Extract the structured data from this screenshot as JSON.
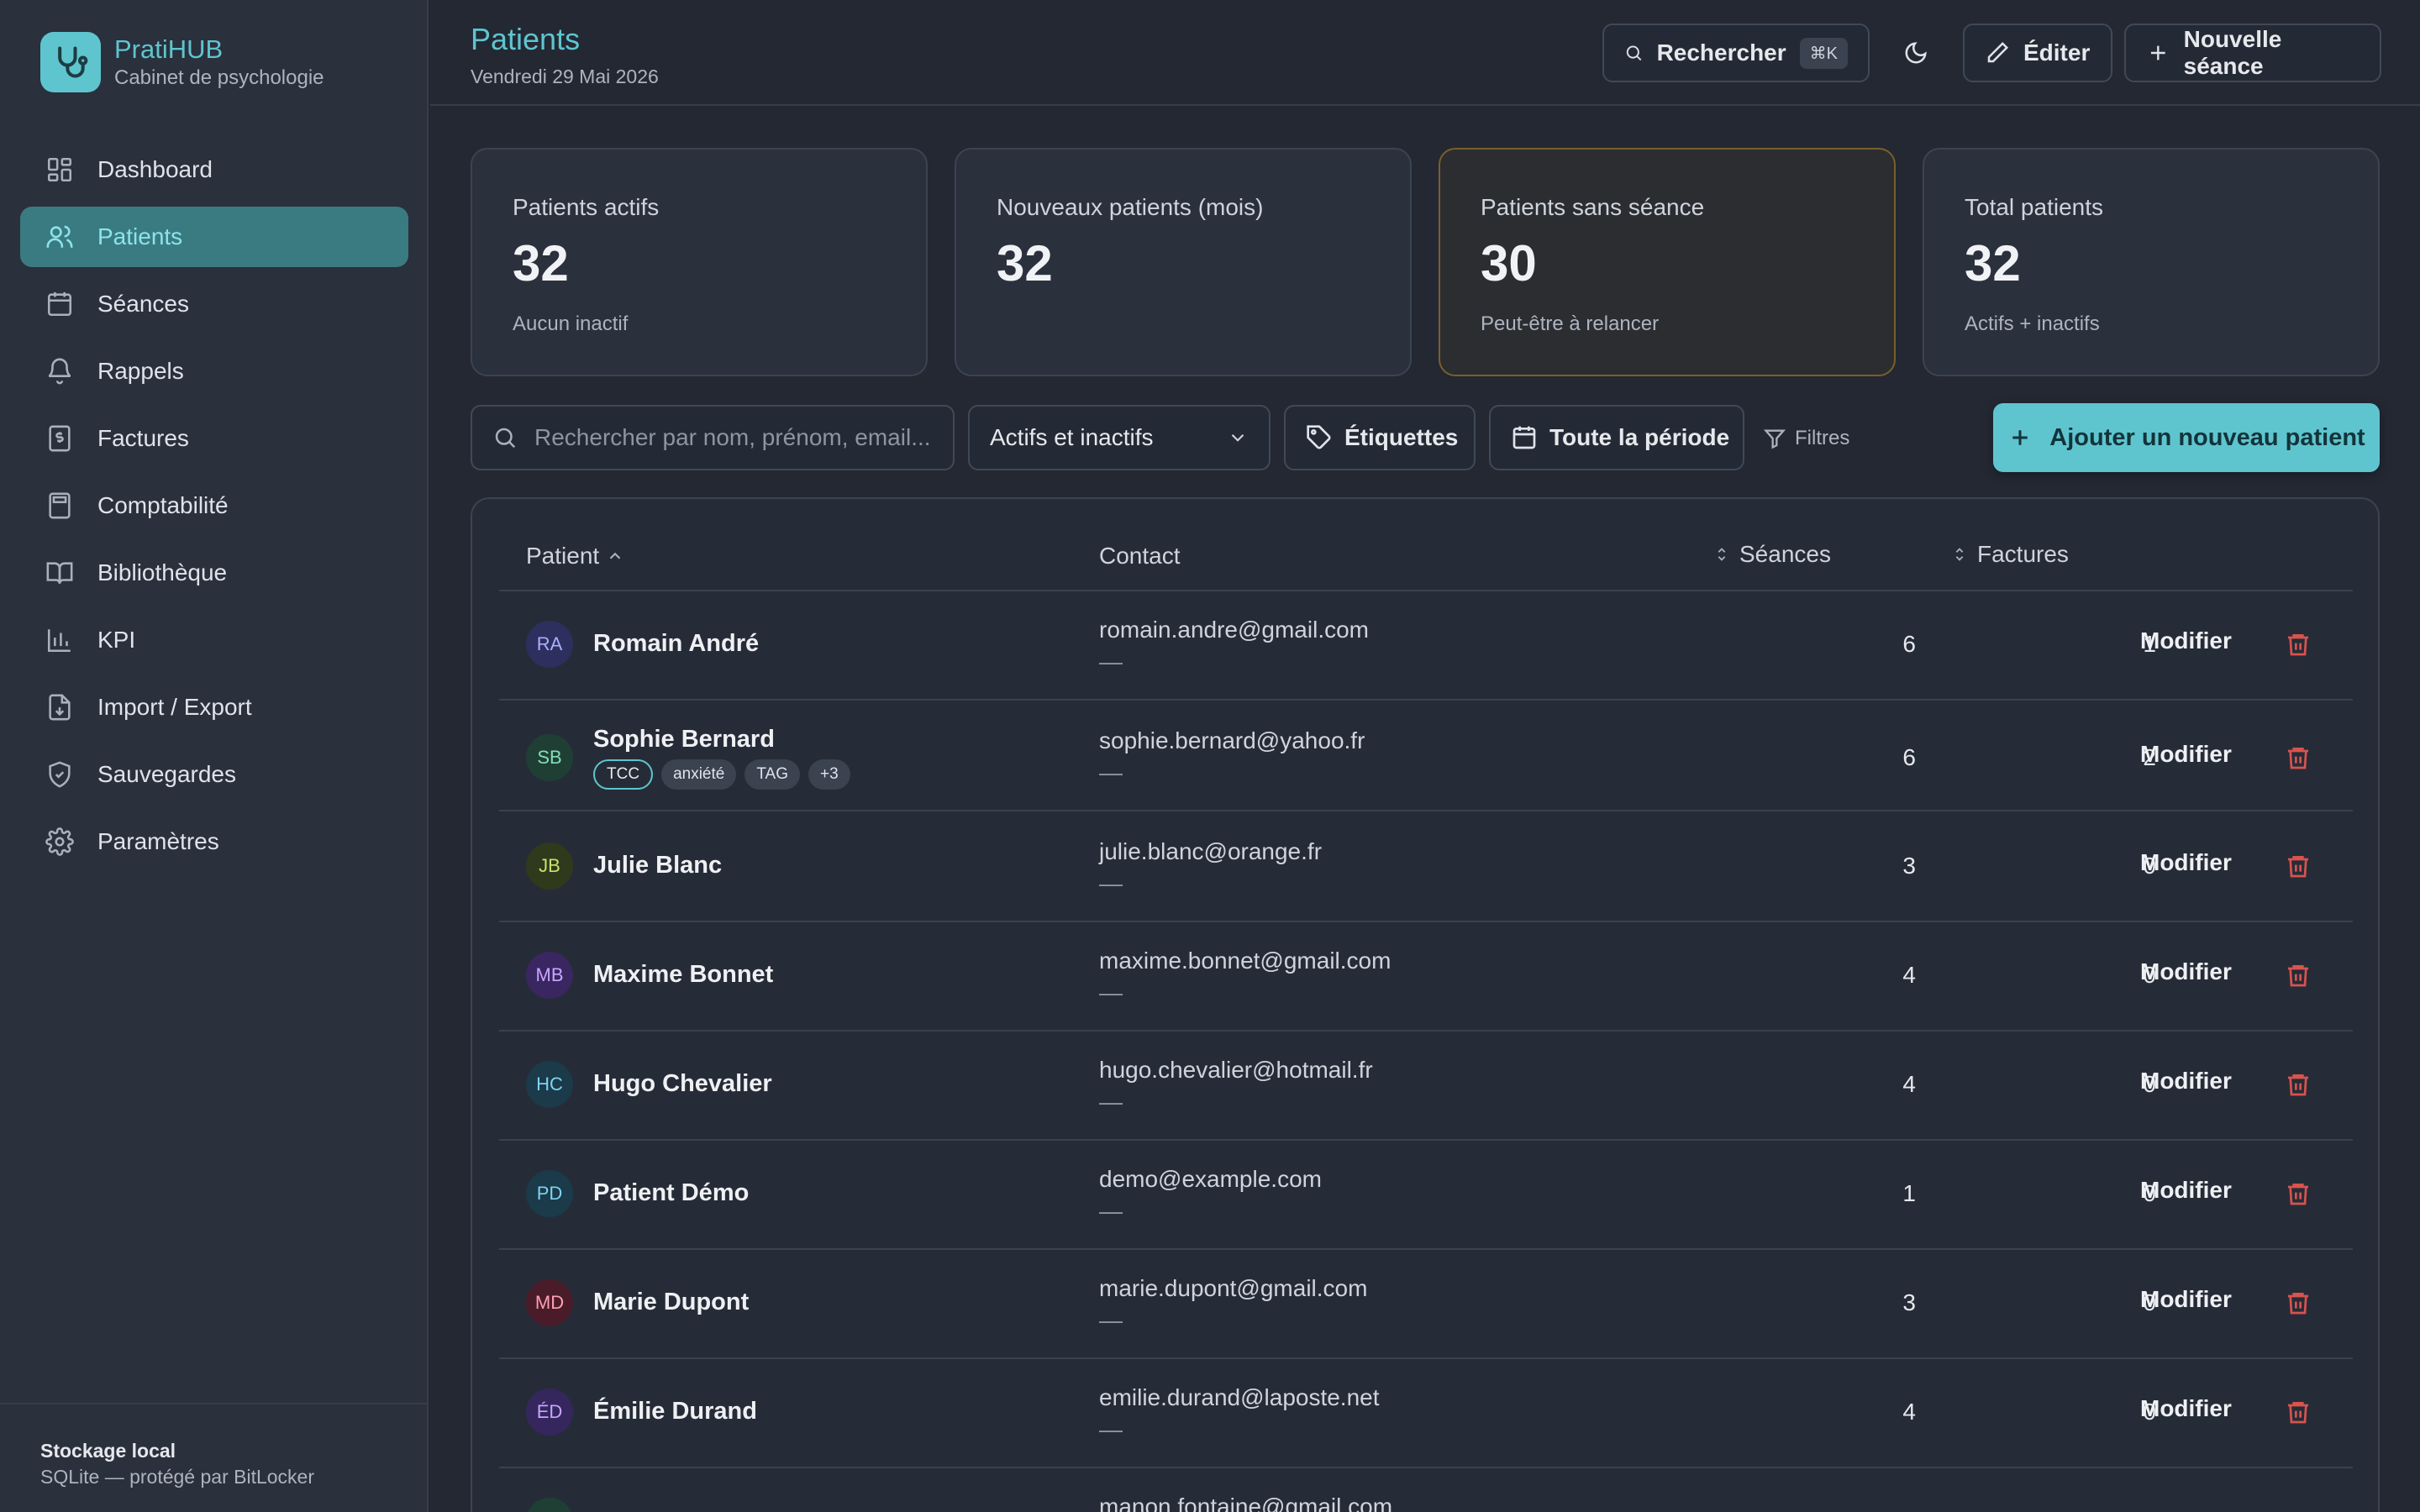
{
  "brand": {
    "name": "PratiHUB",
    "subtitle": "Cabinet de psychologie",
    "logo_icon": "stethoscope-icon",
    "accent": "#5ec5cf"
  },
  "sidebar": {
    "items": [
      {
        "label": "Dashboard",
        "icon": "dashboard-icon",
        "active": false
      },
      {
        "label": "Patients",
        "icon": "users-icon",
        "active": true
      },
      {
        "label": "Séances",
        "icon": "calendar-icon",
        "active": false
      },
      {
        "label": "Rappels",
        "icon": "bell-icon",
        "active": false
      },
      {
        "label": "Factures",
        "icon": "invoice-icon",
        "active": false
      },
      {
        "label": "Comptabilité",
        "icon": "calculator-icon",
        "active": false
      },
      {
        "label": "Bibliothèque",
        "icon": "book-icon",
        "active": false
      },
      {
        "label": "KPI",
        "icon": "bar-chart-icon",
        "active": false
      },
      {
        "label": "Import / Export",
        "icon": "file-import-icon",
        "active": false
      },
      {
        "label": "Sauvegardes",
        "icon": "shield-icon",
        "active": false
      },
      {
        "label": "Paramètres",
        "icon": "gear-icon",
        "active": false
      }
    ],
    "footer": {
      "title": "Stockage local",
      "subtitle": "SQLite — protégé par BitLocker"
    }
  },
  "header": {
    "title": "Patients",
    "date": "Vendredi 29 Mai 2026",
    "search_label": "Rechercher",
    "search_shortcut": "⌘K",
    "edit_label": "Éditer",
    "new_session_label": "Nouvelle séance"
  },
  "stats": [
    {
      "label": "Patients actifs",
      "value": "32",
      "sub": "Aucun inactif"
    },
    {
      "label": "Nouveaux patients (mois)",
      "value": "32",
      "sub": ""
    },
    {
      "label": "Patients sans séance",
      "value": "30",
      "sub": "Peut-être à relancer"
    },
    {
      "label": "Total patients",
      "value": "32",
      "sub": "Actifs + inactifs"
    }
  ],
  "toolbar": {
    "search_placeholder": "Rechercher par nom, prénom, email...",
    "status_select": "Actifs et inactifs",
    "tags_label": "Étiquettes",
    "period_label": "Toute la période",
    "filters_label": "Filtres",
    "add_label": "Ajouter un nouveau patient"
  },
  "table": {
    "columns": {
      "patient": "Patient",
      "contact": "Contact",
      "sessions": "Séances",
      "invoices": "Factures"
    },
    "action_label": "Modifier",
    "rows": [
      {
        "initials": "RA",
        "name": "Romain André",
        "email": "romain.andre@gmail.com",
        "phone": "—",
        "sessions": "6",
        "invoices": "1",
        "avatar_bg": "#2d2f5e",
        "avatar_fg": "#a9b0ff",
        "tags": []
      },
      {
        "initials": "SB",
        "name": "Sophie Bernard",
        "email": "sophie.bernard@yahoo.fr",
        "phone": "—",
        "sessions": "6",
        "invoices": "2",
        "avatar_bg": "#1f3f35",
        "avatar_fg": "#7fe0b5",
        "tags": [
          "TCC",
          "anxiété",
          "TAG",
          "+3"
        ]
      },
      {
        "initials": "JB",
        "name": "Julie Blanc",
        "email": "julie.blanc@orange.fr",
        "phone": "—",
        "sessions": "3",
        "invoices": "0",
        "avatar_bg": "#2f3a1c",
        "avatar_fg": "#c6e36b",
        "tags": []
      },
      {
        "initials": "MB",
        "name": "Maxime Bonnet",
        "email": "maxime.bonnet@gmail.com",
        "phone": "—",
        "sessions": "4",
        "invoices": "0",
        "avatar_bg": "#3a2660",
        "avatar_fg": "#c7a6ff",
        "tags": []
      },
      {
        "initials": "HC",
        "name": "Hugo Chevalier",
        "email": "hugo.chevalier@hotmail.fr",
        "phone": "—",
        "sessions": "4",
        "invoices": "0",
        "avatar_bg": "#1b3a4a",
        "avatar_fg": "#7fd3f0",
        "tags": []
      },
      {
        "initials": "PD",
        "name": "Patient Démo",
        "email": "demo@example.com",
        "phone": "—",
        "sessions": "1",
        "invoices": "0",
        "avatar_bg": "#1b3a4a",
        "avatar_fg": "#7fd3f0",
        "tags": []
      },
      {
        "initials": "MD",
        "name": "Marie Dupont",
        "email": "marie.dupont@gmail.com",
        "phone": "—",
        "sessions": "3",
        "invoices": "0",
        "avatar_bg": "#4a1c2a",
        "avatar_fg": "#ff9fb5",
        "tags": []
      },
      {
        "initials": "ÉD",
        "name": "Émilie Durand",
        "email": "emilie.durand@laposte.net",
        "phone": "—",
        "sessions": "4",
        "invoices": "0",
        "avatar_bg": "#35265e",
        "avatar_fg": "#c7a6ff",
        "tags": []
      },
      {
        "initials": "",
        "name": "",
        "email": "manon.fontaine@gmail.com",
        "phone": "",
        "sessions": "",
        "invoices": "",
        "avatar_bg": "#1f3f35",
        "avatar_fg": "#7fe0b5",
        "tags": []
      }
    ]
  }
}
